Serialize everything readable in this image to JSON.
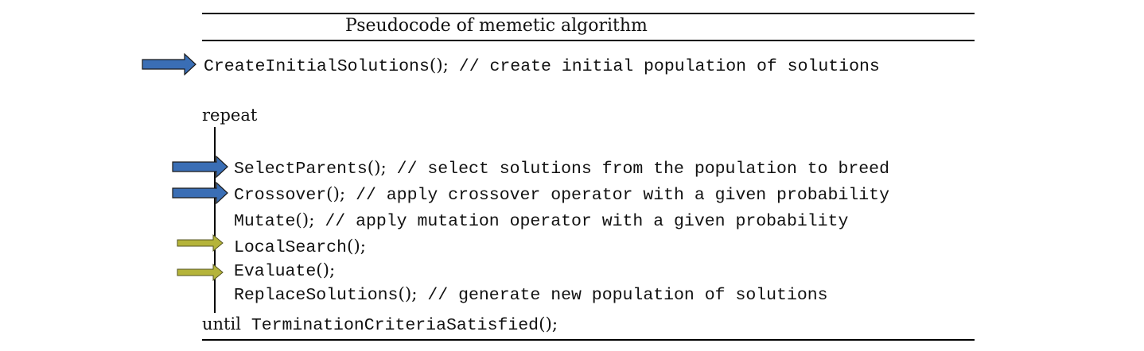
{
  "header": {
    "title": "Pseudocode of memetic algorithm"
  },
  "lines": {
    "create": {
      "call": "CreateInitialSolutions",
      "parens": "()",
      "sep": ";",
      "comment": "// create initial population of solutions"
    },
    "repeat": {
      "keyword": "repeat"
    },
    "select": {
      "call": "SelectParents",
      "parens": "()",
      "sep": ";",
      "comment": "// select solutions from the population to breed"
    },
    "crossover": {
      "call": "Crossover",
      "parens": "()",
      "sep": ";",
      "comment": "// apply crossover operator with a given probability"
    },
    "mutate": {
      "call": "Mutate",
      "parens": "()",
      "sep": ";",
      "comment": "// apply mutation operator with a given probability"
    },
    "local": {
      "call": "LocalSearch",
      "parens": "()",
      "sep": ";",
      "comment": ""
    },
    "evaluate": {
      "call": "Evaluate",
      "parens": "()",
      "sep": ";",
      "comment": ""
    },
    "replace": {
      "call": "ReplaceSolutions",
      "parens": "()",
      "sep": ";",
      "comment": "// generate new population of solutions"
    },
    "until": {
      "keyword": "until",
      "call": "TerminationCriteriaSatisfied",
      "parens": "()",
      "sep": ";"
    }
  },
  "colors": {
    "blue_arrow": "#3a6eb5",
    "olive_arrow": "#b5b43a",
    "arrow_outline": "#1a1a1a"
  },
  "icons": {
    "blue": "right-arrow-icon",
    "olive": "right-arrow-icon"
  }
}
